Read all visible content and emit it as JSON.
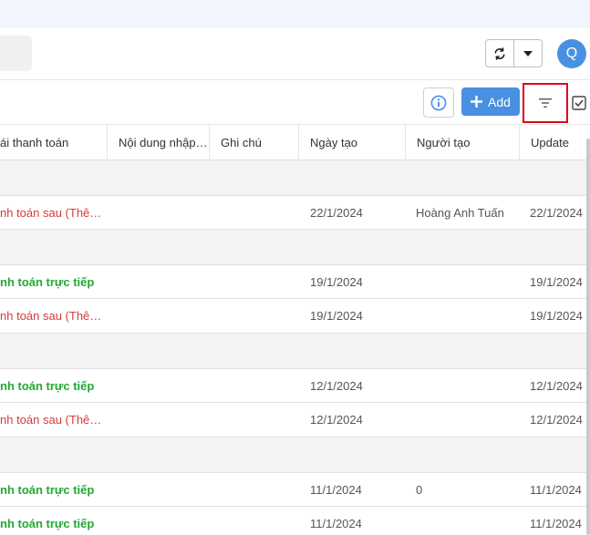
{
  "header": {
    "avatar_letter": "Q"
  },
  "toolbar": {
    "add_label": "Add"
  },
  "table": {
    "columns": [
      "ái thanh toán",
      "Nội dung nhập…",
      "Ghi chú",
      "Ngày tạo",
      "Người tạo",
      "Update"
    ],
    "rows": [
      {
        "status": "nh toán sau (Thê…",
        "status_type": "red",
        "noi_dung": "",
        "ghi_chu": "",
        "ngay_tao": "22/1/2024",
        "nguoi_tao": "Hoàng Anh Tuấn",
        "update": "22/1/2024"
      },
      {
        "status": "nh toán trực tiếp",
        "status_type": "green",
        "noi_dung": "",
        "ghi_chu": "",
        "ngay_tao": "19/1/2024",
        "nguoi_tao": "",
        "update": "19/1/2024"
      },
      {
        "status": "nh toán sau (Thê…",
        "status_type": "red",
        "noi_dung": "",
        "ghi_chu": "",
        "ngay_tao": "19/1/2024",
        "nguoi_tao": "",
        "update": "19/1/2024"
      },
      {
        "status": "nh toán trực tiếp",
        "status_type": "green",
        "noi_dung": "",
        "ghi_chu": "",
        "ngay_tao": "12/1/2024",
        "nguoi_tao": "",
        "update": "12/1/2024"
      },
      {
        "status": "nh toán sau (Thê…",
        "status_type": "red",
        "noi_dung": "",
        "ghi_chu": "",
        "ngay_tao": "12/1/2024",
        "nguoi_tao": "",
        "update": "12/1/2024"
      },
      {
        "status": "nh toán trực tiếp",
        "status_type": "green",
        "noi_dung": "",
        "ghi_chu": "",
        "ngay_tao": "11/1/2024",
        "nguoi_tao": "0",
        "update": "11/1/2024"
      },
      {
        "status": "nh toán trực tiếp",
        "status_type": "green",
        "noi_dung": "",
        "ghi_chu": "",
        "ngay_tao": "11/1/2024",
        "nguoi_tao": "",
        "update": "11/1/2024"
      }
    ]
  },
  "colors": {
    "accent": "#4a90e2",
    "status_red": "#d33b3b",
    "status_green": "#23a834",
    "highlight_border": "#e0001a"
  },
  "icons": [
    "sync-icon",
    "caret-down-icon",
    "info-icon",
    "plus-icon",
    "filter-icon",
    "checkbox-icon"
  ]
}
